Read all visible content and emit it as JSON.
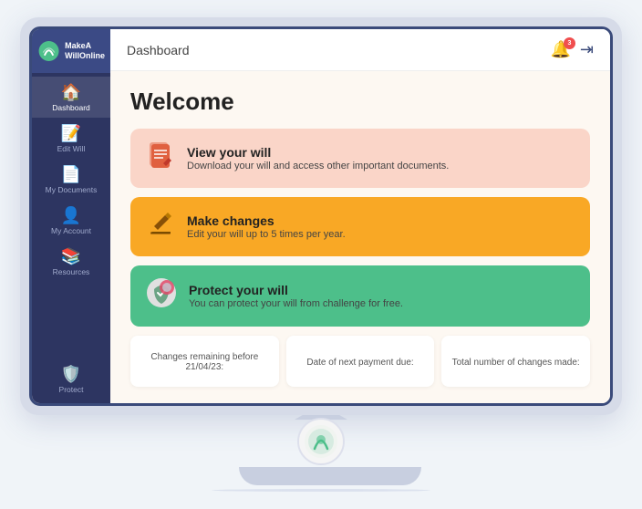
{
  "app": {
    "name": "MakeAWillOnline",
    "logo_line1": "MakeA",
    "logo_line2": "WillOnline"
  },
  "topbar": {
    "title": "Dashboard",
    "notification_count": "3",
    "logout_icon": "→"
  },
  "sidebar": {
    "items": [
      {
        "id": "dashboard",
        "label": "Dashboard",
        "icon": "⌂",
        "active": true
      },
      {
        "id": "edit-will",
        "label": "Edit Will",
        "icon": "✏️"
      },
      {
        "id": "my-documents",
        "label": "My Documents",
        "icon": "📄"
      },
      {
        "id": "my-account",
        "label": "My Account",
        "icon": "👤"
      },
      {
        "id": "resources",
        "label": "Resources",
        "icon": "📚"
      },
      {
        "id": "protect",
        "label": "Protect",
        "icon": "🛡️"
      }
    ]
  },
  "welcome": {
    "title": "Welcome"
  },
  "cards": [
    {
      "id": "view-will",
      "icon": "📋",
      "title": "View your will",
      "description": "Download your will and access other important documents.",
      "color": "pink"
    },
    {
      "id": "make-changes",
      "icon": "✏️",
      "title": "Make changes",
      "description": "Edit your will up to 5 times per year.",
      "color": "orange"
    },
    {
      "id": "protect-will",
      "icon": "🛡️",
      "title": "Protect your will",
      "description": "You can protect your will from challenge for free.",
      "color": "green"
    }
  ],
  "stats": [
    {
      "id": "changes-remaining",
      "label": "Changes remaining before 21/04/23:"
    },
    {
      "id": "next-payment",
      "label": "Date of next payment due:"
    },
    {
      "id": "total-changes",
      "label": "Total number of changes made:"
    }
  ]
}
